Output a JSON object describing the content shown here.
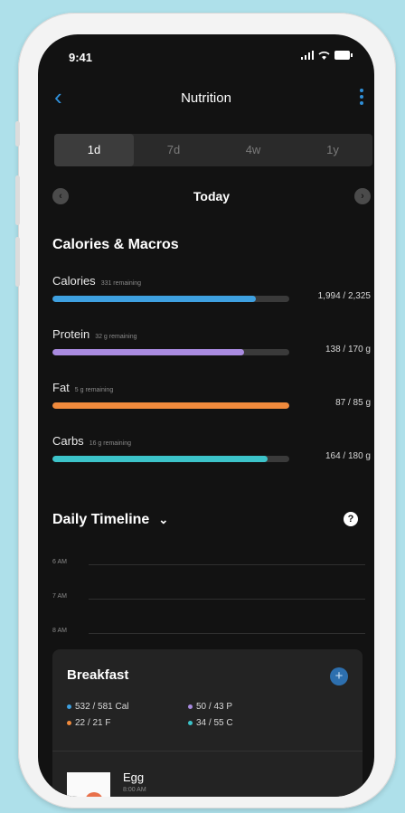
{
  "status": {
    "time": "9:41"
  },
  "nav": {
    "title": "Nutrition"
  },
  "range_tabs": [
    "1d",
    "7d",
    "4w",
    "1y"
  ],
  "active_range": "1d",
  "day": {
    "label": "Today"
  },
  "macros_section": {
    "title": "Calories & Macros"
  },
  "macros": [
    {
      "name": "Calories",
      "remaining": "331 remaining",
      "value": "1,994 / 2,325",
      "progress": 0.857,
      "color": "#3ea0e0"
    },
    {
      "name": "Protein",
      "remaining": "32 g remaining",
      "value": "138 / 170 g",
      "progress": 0.81,
      "color": "#a98be0"
    },
    {
      "name": "Fat",
      "remaining": "5 g remaining",
      "value": "87 / 85 g",
      "progress": 1.0,
      "color": "#f08a3c"
    },
    {
      "name": "Carbs",
      "remaining": "16 g remaining",
      "value": "164 / 180 g",
      "progress": 0.91,
      "color": "#3cc3c9"
    }
  ],
  "timeline": {
    "title": "Daily Timeline",
    "hours": [
      "6 AM",
      "7 AM",
      "8 AM"
    ]
  },
  "meal": {
    "title": "Breakfast",
    "stats": {
      "cal": "532 / 581 Cal",
      "protein": "50 / 43 P",
      "fat": "22 / 21 F",
      "carbs": "34 / 55 C"
    },
    "item": {
      "name": "Egg",
      "detail": "8:00 AM"
    }
  },
  "colors": {
    "accent": "#2f8fd8",
    "background": "#121212",
    "card": "#232323"
  }
}
